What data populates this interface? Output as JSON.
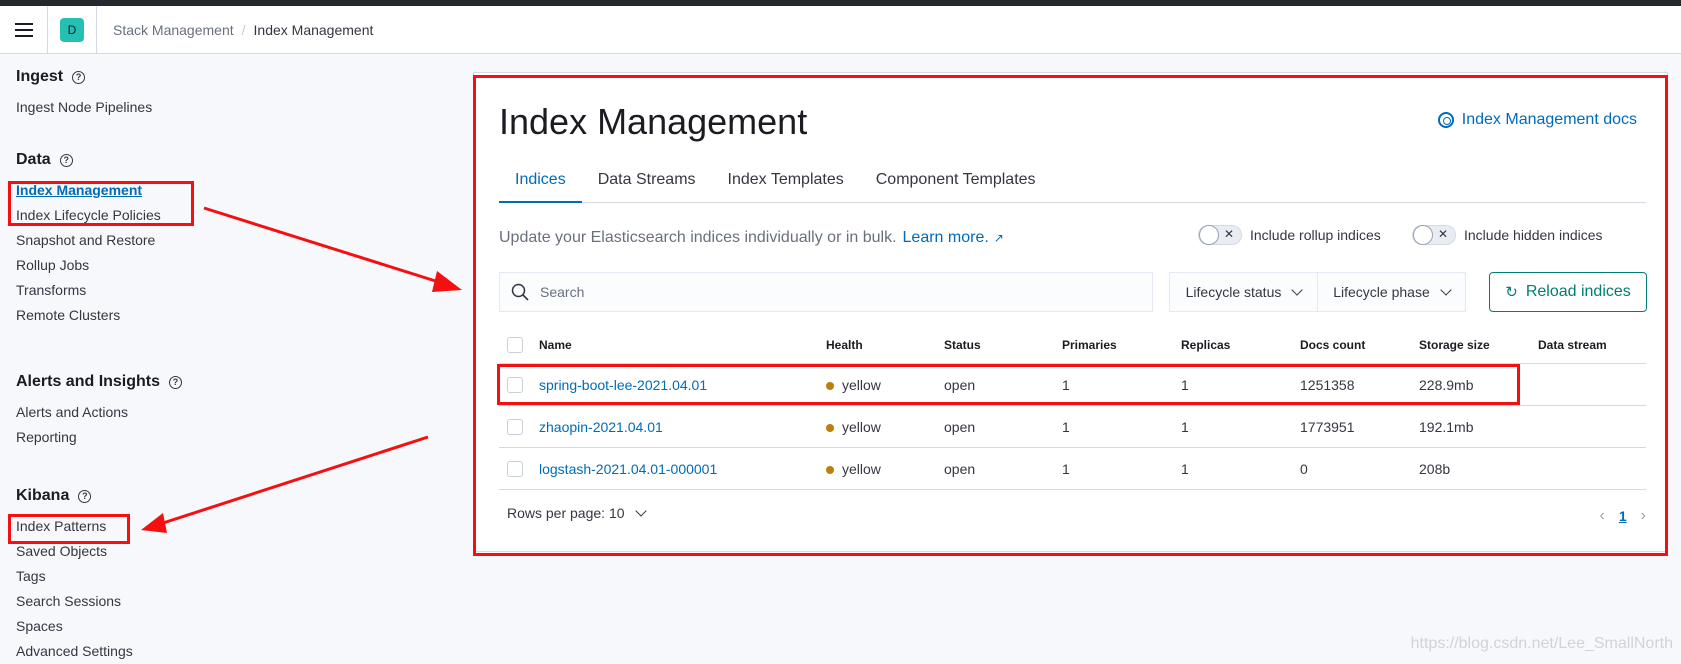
{
  "header": {
    "menu_icon": "hamburger-icon",
    "space_initial": "D",
    "breadcrumbs": [
      "Stack Management",
      "Index Management"
    ]
  },
  "sidebar": {
    "groups": [
      {
        "title": "Ingest",
        "items": [
          "Ingest Node Pipelines"
        ]
      },
      {
        "title": "Data",
        "items": [
          "Index Management",
          "Index Lifecycle Policies",
          "Snapshot and Restore",
          "Rollup Jobs",
          "Transforms",
          "Remote Clusters"
        ]
      },
      {
        "title": "Alerts and Insights",
        "items": [
          "Alerts and Actions",
          "Reporting"
        ]
      },
      {
        "title": "Kibana",
        "items": [
          "Index Patterns",
          "Saved Objects",
          "Tags",
          "Search Sessions",
          "Spaces",
          "Advanced Settings"
        ]
      }
    ],
    "active_item": "Index Management"
  },
  "main": {
    "title": "Index Management",
    "docs_link": "Index Management docs",
    "tabs": [
      "Indices",
      "Data Streams",
      "Index Templates",
      "Component Templates"
    ],
    "active_tab": "Indices",
    "description": "Update your Elasticsearch indices individually or in bulk.",
    "learn_more": "Learn more.",
    "toggle_rollup": "Include rollup indices",
    "toggle_hidden": "Include hidden indices",
    "search_placeholder": "Search",
    "filter_lifecycle_status": "Lifecycle status",
    "filter_lifecycle_phase": "Lifecycle phase",
    "reload_label": "Reload indices",
    "columns": [
      "Name",
      "Health",
      "Status",
      "Primaries",
      "Replicas",
      "Docs count",
      "Storage size",
      "Data stream"
    ],
    "rows": [
      {
        "name": "spring-boot-lee-2021.04.01",
        "health": "yellow",
        "status": "open",
        "primaries": "1",
        "replicas": "1",
        "docs": "1251358",
        "size": "228.9mb",
        "stream": ""
      },
      {
        "name": "zhaopin-2021.04.01",
        "health": "yellow",
        "status": "open",
        "primaries": "1",
        "replicas": "1",
        "docs": "1773951",
        "size": "192.1mb",
        "stream": ""
      },
      {
        "name": "logstash-2021.04.01-000001",
        "health": "yellow",
        "status": "open",
        "primaries": "1",
        "replicas": "1",
        "docs": "0",
        "size": "208b",
        "stream": ""
      }
    ],
    "rows_per_page": "Rows per page: 10",
    "current_page": "1"
  },
  "watermark": "https://blog.csdn.net/Lee_SmallNorth",
  "colors": {
    "accent": "#006bb8",
    "annotation": "#f41010",
    "health_yellow": "#b9800e",
    "reload": "#017d73"
  }
}
